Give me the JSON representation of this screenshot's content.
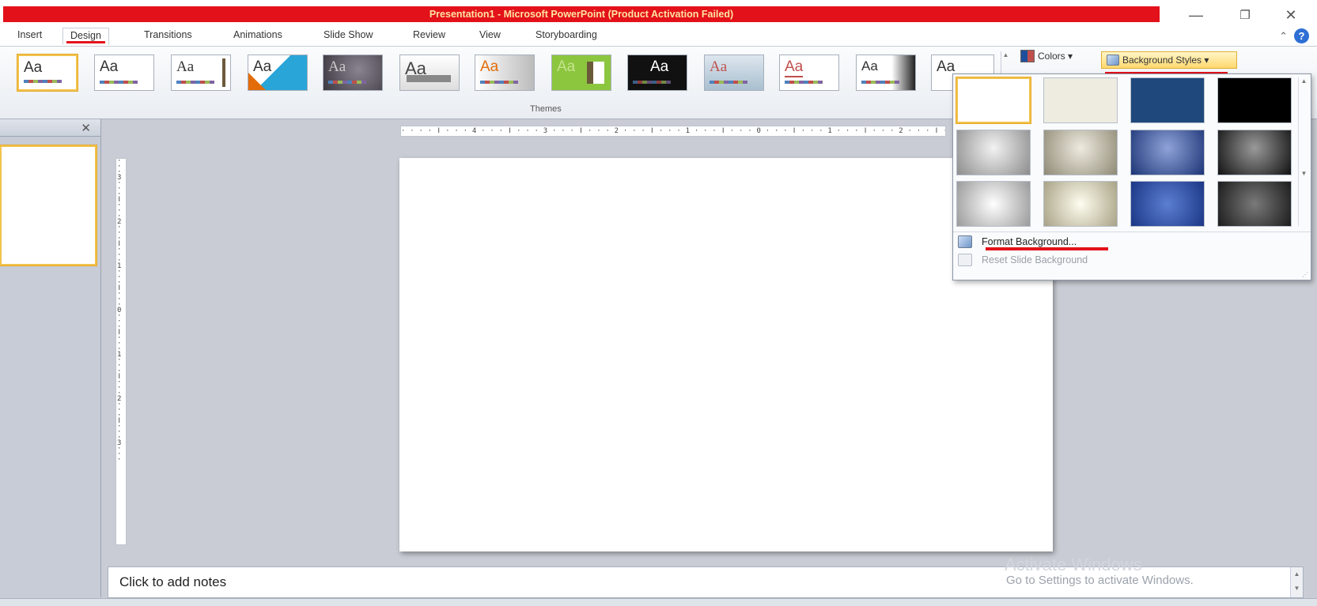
{
  "app": {
    "title": "Presentation1 - Microsoft PowerPoint (Product Activation Failed)",
    "window_controls": [
      "minimize-icon",
      "restore-icon",
      "close-icon"
    ],
    "accent": "#e3111a"
  },
  "tabs": [
    {
      "label": "Insert",
      "active": false
    },
    {
      "label": "Design",
      "active": true
    },
    {
      "label": "Transitions",
      "active": false
    },
    {
      "label": "Animations",
      "active": false
    },
    {
      "label": "Slide Show",
      "active": false
    },
    {
      "label": "Review",
      "active": false
    },
    {
      "label": "View",
      "active": false
    },
    {
      "label": "Storyboarding",
      "active": false
    }
  ],
  "ribbon": {
    "themes_group_label": "Themes",
    "theme_sample_text": "Aa",
    "colors_label": "Colors ▾",
    "background_styles_label": "Background Styles ▾"
  },
  "ruler": {
    "horizontal": "· · · · ǀ · · · 4 · · · ǀ · · · 3 · · · ǀ · · · 2 · · · ǀ · · · 1 · · · ǀ · · · 0 · · · ǀ · · · 1 · · · ǀ · · · 2 · · · ǀ · · · 3 · · ·",
    "vertical": "· · · 3 · · · ǀ · · · 2 · · · ǀ · · · 1 · · · ǀ · · · 0 · · · ǀ · · · 1 · · · ǀ · · · 2 · · · ǀ · · · 3 · · ·"
  },
  "notes": {
    "placeholder": "Click to add notes"
  },
  "watermark": {
    "line1": "Activate Windows",
    "line2": "Go to Settings to activate Windows."
  },
  "background_menu": {
    "swatches": [
      {
        "name": "style-1",
        "color": "#ffffff",
        "selected": true
      },
      {
        "name": "style-2",
        "color": "#eeece1"
      },
      {
        "name": "style-3",
        "color": "#1f497d"
      },
      {
        "name": "style-4",
        "color": "#000000"
      },
      {
        "name": "style-5",
        "color": "#bfbfbf"
      },
      {
        "name": "style-6",
        "color": "#c4bd97"
      },
      {
        "name": "style-7",
        "color": "#4563a8"
      },
      {
        "name": "style-8",
        "color": "#3a3a3a"
      },
      {
        "name": "style-9",
        "color": "#d9d9d9"
      },
      {
        "name": "style-10",
        "color": "#ddd9c3"
      },
      {
        "name": "style-11",
        "color": "#3558b0"
      },
      {
        "name": "style-12",
        "color": "#404040"
      }
    ],
    "format_background_label": "Format Background...",
    "reset_background_label": "Reset Slide Background"
  }
}
